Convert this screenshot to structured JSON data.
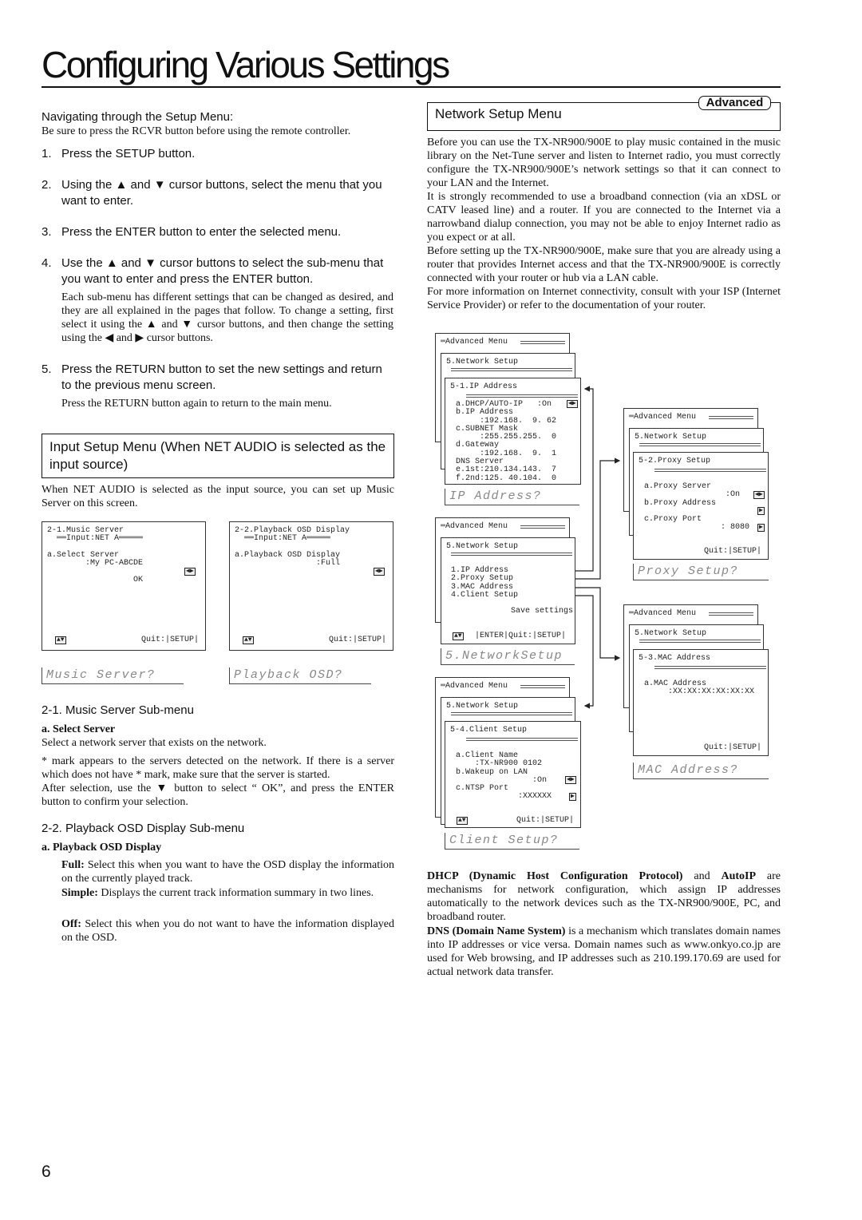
{
  "title": "Configuring Various Settings",
  "page_number": "6",
  "left": {
    "nav_heading": "Navigating through the Setup Menu:",
    "nav_note": "Be sure to press the RCVR button before using the remote controller.",
    "steps": [
      {
        "n": "1.",
        "text": "Press the SETUP button."
      },
      {
        "n": "2.",
        "text": "Using the ▲ and ▼ cursor buttons, select the menu that you want to enter."
      },
      {
        "n": "3.",
        "text": "Press the ENTER button to enter the selected menu."
      },
      {
        "n": "4.",
        "text": "Use the ▲ and ▼ cursor buttons to select the sub-menu that you want to enter and press the ENTER button."
      },
      {
        "n": "5.",
        "text": "Press the RETURN button to set the new settings and return to the previous menu screen."
      }
    ],
    "step4_note": "Each sub-menu has different settings that can be changed as desired, and they are all explained in the pages that follow. To change a setting, first select it using the ▲ and ▼ cursor buttons, and then change the setting using the ◀ and ▶ cursor buttons.",
    "step5_note": "Press the RETURN button again to return to the main menu.",
    "input_box": "Input Setup Menu (When NET AUDIO is selected as the input source)",
    "input_para": "When NET AUDIO is selected as the input source, you can set up Music Server on this screen.",
    "screen_music": {
      "lines": [
        "2-1.Music Server",
        "  ══Input:NET A═════",
        "",
        "a.Select Server",
        "        :My PC-ABCDE  ",
        "",
        "                  OK"
      ],
      "footer": "Quit:|SETUP|",
      "prompt": "Music Server?"
    },
    "screen_osd": {
      "lines": [
        "2-2.Playback OSD Display",
        "  ══Input:NET A═════",
        "",
        "a.Playback OSD Display",
        "                 :Full  "
      ],
      "footer": "Quit:|SETUP|",
      "prompt": "Playback OSD?"
    },
    "sub21_heading": "2-1. Music Server Sub-menu",
    "sub21_a": "a. Select Server",
    "sub21_p1": "Select a network server that exists on the network.",
    "sub21_p2": "* mark appears to the servers detected on the network. If there is a server which does not have * mark, make sure that the server is started.",
    "sub21_p3": "After selection, use the ▼ button to select “ OK”, and press the ENTER button to confirm your selection.",
    "sub22_heading": "2-2. Playback OSD Display Sub-menu",
    "sub22_a": "a. Playback OSD Display",
    "options": [
      {
        "term": "Full:",
        "desc": "Select this when you want to have the OSD display the information on the currently played track."
      },
      {
        "term": "Simple:",
        "desc": "Displays the current track information summary in two lines."
      },
      {
        "term": "Off:",
        "desc": "Select this when you do not want to have the information displayed on the OSD."
      }
    ]
  },
  "right": {
    "badge": "Advanced",
    "heading": "Network Setup Menu",
    "paras": [
      "Before you can use the TX-NR900/900E to play music contained in the music library on the Net-Tune server and listen to Internet radio, you must correctly configure the TX-NR900/900E’s network settings so that it can connect to your LAN and the Internet.",
      "It is strongly recommended to use a broadband connection (via an xDSL or CATV leased line) and a router. If you are connected to the Internet via a narrowband dialup connection, you may not be able to enjoy Internet radio as you expect or at all.",
      "Before setting up the TX-NR900/900E, make sure that you are already using a router that provides Internet access and that the TX-NR900/900E is correctly connected with your router or hub via a LAN cable.",
      "For more information on Internet connectivity, consult with your ISP (Internet Service Provider) or refer to the documentation of your router."
    ],
    "adv_menu": "═Advanced Menu",
    "net_setup": "5.Network Setup",
    "screen_ip": {
      "title": "5-1.IP Address",
      "lines": [
        "a.DHCP/AUTO-IP   :On",
        "b.IP Address",
        "     :192.168.  9. 62",
        "c.SUBNET Mask",
        "     :255.255.255.  0",
        "d.Gateway",
        "     :192.168.  9.  1",
        "DNS Server",
        "e.1st:210.134.143.  7",
        "f.2nd:125. 40.104.  0"
      ],
      "prompt": "IP Address?"
    },
    "screen_main": {
      "lines": [
        "1.IP Address",
        "2.Proxy Setup",
        "3.MAC Address",
        "4.Client Setup"
      ],
      "save": "Save settings",
      "footer": "|ENTER|Quit:|SETUP|",
      "prompt": "5.NetworkSetup"
    },
    "screen_client": {
      "title": "5-4.Client Setup",
      "lines": [
        "a.Client Name",
        "    :TX-NR900 0102",
        "b.Wakeup on LAN",
        "                :On",
        "c.NTSP Port",
        "             :XXXXXX"
      ],
      "footer": "Quit:|SETUP|",
      "prompt": "Client Setup?"
    },
    "screen_proxy": {
      "title": "5-2.Proxy Setup",
      "lines": [
        "a.Proxy Server",
        "                 :On",
        "b.Proxy Address",
        "",
        "c.Proxy Port",
        "                : 8080"
      ],
      "footer": "Quit:|SETUP|",
      "prompt": "Proxy Setup?"
    },
    "screen_mac": {
      "title": "5-3.MAC Address",
      "lines": [
        "a.MAC Address",
        "     :XX:XX:XX:XX:XX:XX"
      ],
      "footer": "Quit:|SETUP|",
      "prompt": "MAC Address?"
    },
    "dhcp_term": "DHCP (Dynamic Host Configuration Protocol)",
    "dhcp_mid": " and ",
    "autoip_term": "AutoIP",
    "dhcp_text": " are mechanisms for network configuration, which assign IP addresses automatically to the network devices such as the TX-NR900/900E, PC, and broadband router.",
    "dns_term": "DNS (Domain Name System)",
    "dns_text": " is a mechanism which translates domain names into IP addresses or vice versa. Domain names such as www.onkyo.co.jp are used for Web browsing, and IP addresses such as 210.199.170.69 are used for actual network data transfer."
  },
  "icons": {
    "updown": "▲▼",
    "leftright": "◀▶",
    "right": "▶"
  }
}
